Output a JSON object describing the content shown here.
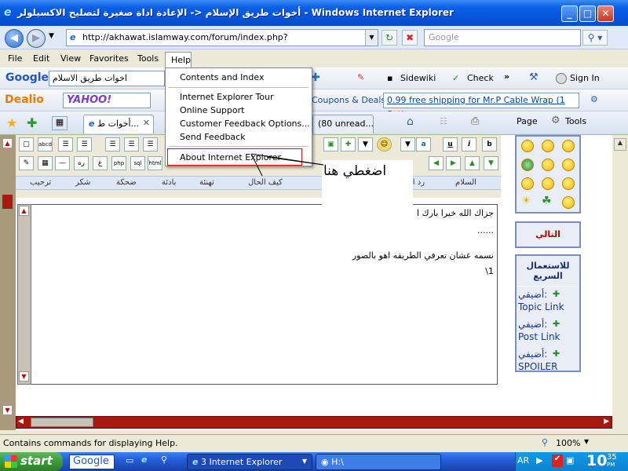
{
  "window": {
    "title": "أخوات طريق الإسلام <- الإعادة اداة صغيرة لتصليح الاكسيلولر - Windows Internet Explorer",
    "min_symbol": "_",
    "max_symbol": "□",
    "close_symbol": "✕"
  },
  "address": {
    "url": "http://akhawat.islamway.com/forum/index.php?",
    "search_placeholder": "Google"
  },
  "menu": [
    "File",
    "Edit",
    "View",
    "Favorites",
    "Tools",
    "Help"
  ],
  "google_toolbar": {
    "logo": "Google",
    "search_value": "اخوات طريق الاسلام",
    "sidewiki": "Sidewiki",
    "check": "Check",
    "signin": "Sign In"
  },
  "dealio_toolbar": {
    "logo": "Dealio",
    "yahoo": "YAHOO!",
    "coupons": "Coupons & Deals",
    "deal_text": "0.99 free shipping for Mr.P Cable Wrap (1 Set)"
  },
  "tabs": {
    "tab1": "أخوات ط...",
    "tab2": "(80 unread...",
    "page_label": "Page",
    "tools_label": "Tools"
  },
  "help_menu": {
    "items": [
      "Contents and Index",
      "Internet Explorer Tour",
      "Online Support",
      "Customer Feedback Options...",
      "Send Feedback",
      "About Internet Explorer"
    ]
  },
  "callout": {
    "text": "اضغطي هنا"
  },
  "editor": {
    "smilie_labels": [
      "السلام",
      "رد الس",
      "كيف الحال",
      "تهنئة",
      "بادئة",
      "ضحكة",
      "شكر",
      "ترحيب"
    ],
    "lines": [
      "جزاك الله خيرا بارك ا",
      "......",
      "نسمه عشان تعرفي الطريقه اهو بالصور",
      "1\\"
    ]
  },
  "sidebar": {
    "next": "التالي",
    "quick_title": "للاستعمال السريع",
    "links": [
      {
        "add": "أضيفي:",
        "label": "Topic Link"
      },
      {
        "add": "أضيفي:",
        "label": "Post Link"
      },
      {
        "add": "أضيفي:",
        "label": "SPOILER"
      }
    ]
  },
  "status": {
    "text": "Contains commands for displaying Help.",
    "zoom": "100%"
  },
  "taskbar": {
    "start": "start",
    "google": "Google",
    "ie_task": "3 Internet Explorer",
    "drive_task": "H:\\",
    "lang": "AR",
    "clock": "10",
    "clock_min": "35",
    "ampm": "PM"
  }
}
